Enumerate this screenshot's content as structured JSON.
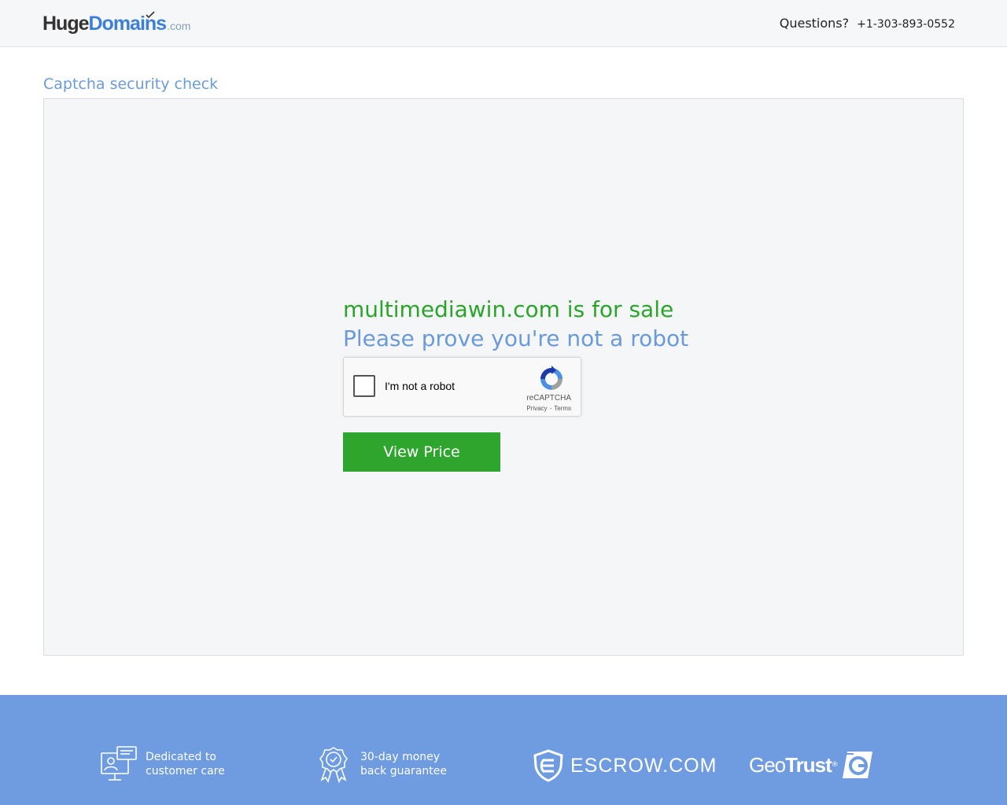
{
  "header": {
    "logo": {
      "huge": "Huge",
      "domains": "Domains",
      "com": ".com"
    },
    "questions_label": "Questions?",
    "phone": "+1-303-893-0552"
  },
  "main": {
    "page_title": "Captcha security check",
    "sale_heading": "multimediawin.com is for sale",
    "robot_heading": "Please prove you're not a robot",
    "recaptcha": {
      "label": "I'm not a robot",
      "brand": "reCAPTCHA",
      "privacy": "Privacy",
      "separator": "-",
      "terms": "Terms"
    },
    "view_price_label": "View Price"
  },
  "footer": {
    "features": [
      {
        "icon": "customer-care-icon",
        "line1": "Dedicated to",
        "line2": "customer care"
      },
      {
        "icon": "guarantee-ribbon-icon",
        "line1": "30-day money",
        "line2": "back guarantee"
      }
    ],
    "escrow_label": "ESCROW.COM",
    "geotrust": {
      "geo": "Geo",
      "trust": "Trust",
      "reg": "®"
    }
  },
  "colors": {
    "accent_blue": "#6b9ad8",
    "sale_green": "#2aa52a",
    "button_green": "#2ea62e",
    "footer_blue": "#6f9be0"
  }
}
